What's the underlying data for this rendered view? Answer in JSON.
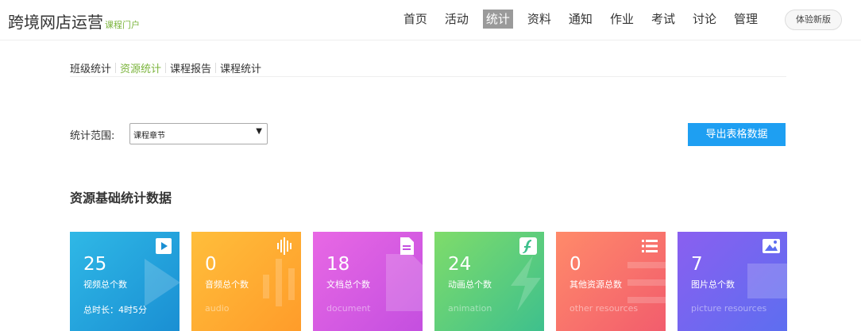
{
  "header": {
    "course_title": "跨境网店运营",
    "portal_label": "课程门户",
    "nav": [
      "首页",
      "活动",
      "统计",
      "资料",
      "通知",
      "作业",
      "考试",
      "讨论",
      "管理"
    ],
    "active_nav": "统计",
    "new_version_label": "体验新版"
  },
  "subnav": {
    "items": [
      "班级统计",
      "资源统计",
      "课程报告",
      "课程统计"
    ],
    "active": "资源统计"
  },
  "filter": {
    "label": "统计范围:",
    "selected": "课程章节",
    "export_label": "导出表格数据"
  },
  "section_title": "资源基础统计数据",
  "cards": [
    {
      "count": "25",
      "label": "视频总个数",
      "extra": "总时长：4时5分",
      "icon": "video-icon",
      "colors": [
        "#2fb8e6",
        "#1a8fd3"
      ]
    },
    {
      "count": "0",
      "label": "音频总个数",
      "extra": "audio",
      "icon": "audio-wave-icon",
      "colors": [
        "#ffbe3b",
        "#ff9c2a"
      ]
    },
    {
      "count": "18",
      "label": "文档总个数",
      "extra": "document",
      "icon": "document-icon",
      "colors": [
        "#e868e4",
        "#c44fe0"
      ]
    },
    {
      "count": "24",
      "label": "动画总个数",
      "extra": "animation",
      "icon": "flash-icon",
      "colors": [
        "#7fdc6a",
        "#3ec08d"
      ]
    },
    {
      "count": "0",
      "label": "其他资源总数",
      "extra": "other resources",
      "icon": "list-icon",
      "colors": [
        "#ff8a6a",
        "#f25d6d"
      ]
    },
    {
      "count": "7",
      "label": "图片总个数",
      "extra": "picture resources",
      "icon": "image-icon",
      "colors": [
        "#8a5ff0",
        "#5d6ef0"
      ]
    }
  ]
}
